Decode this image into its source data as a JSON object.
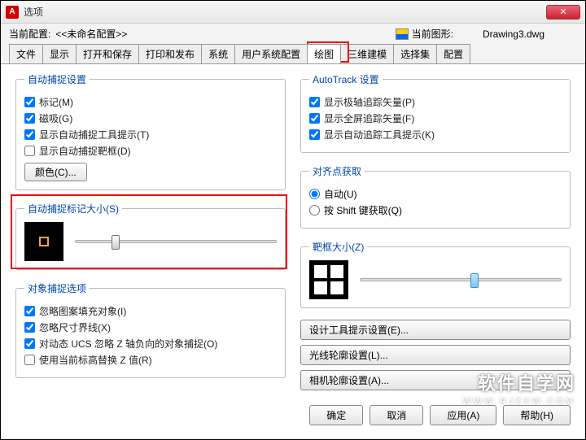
{
  "window": {
    "title": "选项"
  },
  "header": {
    "profile_label": "当前配置:",
    "profile_value": "<<未命名配置>>",
    "drawing_label": "当前图形:",
    "drawing_value": "Drawing3.dwg"
  },
  "tabs": [
    "文件",
    "显示",
    "打开和保存",
    "打印和发布",
    "系统",
    "用户系统配置",
    "绘图",
    "三维建模",
    "选择集",
    "配置"
  ],
  "active_tab_index": 6,
  "left": {
    "autosnap": {
      "legend": "自动捕捉设置",
      "marker": "标记(M)",
      "magnet": "磁吸(G)",
      "tooltip": "显示自动捕捉工具提示(T)",
      "aperture": "显示自动捕捉靶框(D)",
      "colors_btn": "颜色(C)..."
    },
    "marker_size": {
      "legend": "自动捕捉标记大小(S)",
      "slider_pos_pct": 18
    },
    "osnap": {
      "legend": "对象捕捉选项",
      "hatch": "忽略图案填充对象(I)",
      "dimext": "忽略尺寸界线(X)",
      "negz": "对动态 UCS 忽略 Z 轴负向的对象捕捉(O)",
      "replacez": "使用当前标高替换 Z 值(R)"
    }
  },
  "right": {
    "autotrack": {
      "legend": "AutoTrack 设置",
      "polar": "显示极轴追踪矢量(P)",
      "full": "显示全屏追踪矢量(F)",
      "tooltip": "显示自动追踪工具提示(K)"
    },
    "alignment": {
      "legend": "对齐点获取",
      "auto": "自动(U)",
      "shift": "按 Shift 键获取(Q)"
    },
    "aperture_size": {
      "legend": "靶框大小(Z)",
      "slider_pos_pct": 55
    },
    "buttons": {
      "design_tooltip": "设计工具提示设置(E)...",
      "light_glyph": "光线轮廓设置(L)...",
      "camera_glyph": "相机轮廓设置(A)..."
    }
  },
  "bottom": {
    "ok": "确定",
    "cancel": "取消",
    "apply": "应用(A)",
    "help": "帮助(H)"
  },
  "watermark": {
    "main": "软件自学网",
    "sub": "WWW.RJZXW.COM"
  }
}
